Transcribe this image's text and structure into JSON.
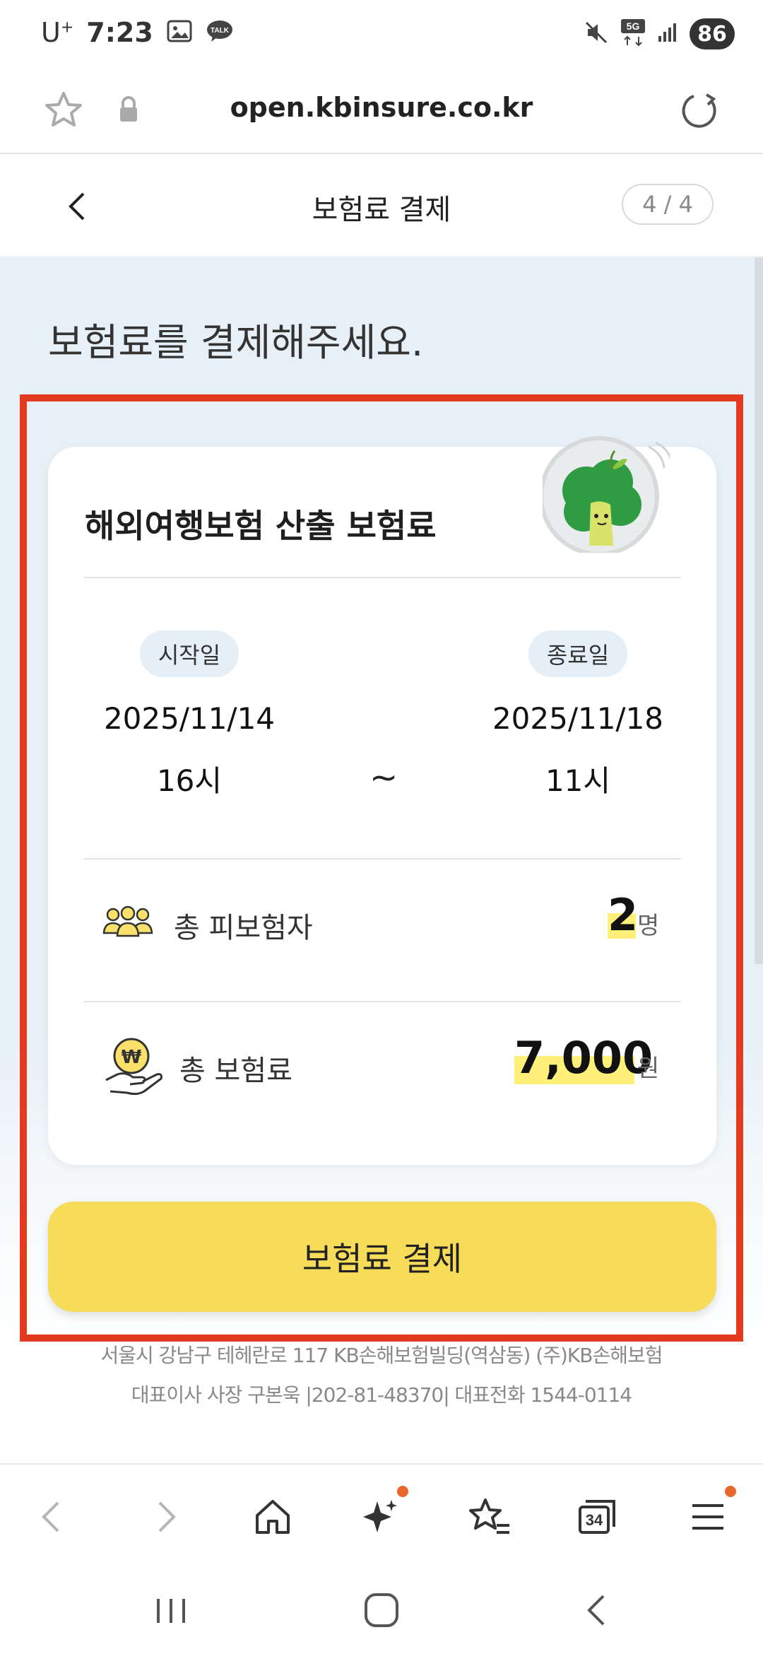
{
  "status_bar": {
    "carrier": "U",
    "carrier_sup": "+",
    "time": "7:23",
    "network": "5G",
    "battery": "86"
  },
  "url_bar": {
    "url": "open.kbinsure.co.kr"
  },
  "header": {
    "title": "보험료 결제",
    "step": "4 / 4"
  },
  "main": {
    "headline": "보험료를 결제해주세요.",
    "card": {
      "title": "해외여행보험 산출 보험료",
      "start_label": "시작일",
      "start_date": "2025/11/14",
      "start_hour": "16시",
      "separator": "~",
      "end_label": "종료일",
      "end_date": "2025/11/18",
      "end_hour": "11시",
      "insured_label": "총 피보험자",
      "insured_value": "2",
      "insured_unit": "명",
      "premium_label": "총 보험료",
      "premium_value": "7,000",
      "premium_unit": "원"
    },
    "pay_button": "보험료 결제"
  },
  "footer": {
    "line1": "서울시 강남구 테헤란로 117 KB손해보험빌딩(역삼동) (주)KB손해보험",
    "line2": "대표이사 사장 구본욱 |202-81-48370| 대표전화 1544-0114"
  },
  "browser_nav": {
    "tabs_count": "34"
  },
  "colors": {
    "accent_yellow": "#f7dc5a",
    "highlight_red": "#e23b1f",
    "background_blue": "#e6f0f6",
    "notification_orange": "#e8682e"
  }
}
